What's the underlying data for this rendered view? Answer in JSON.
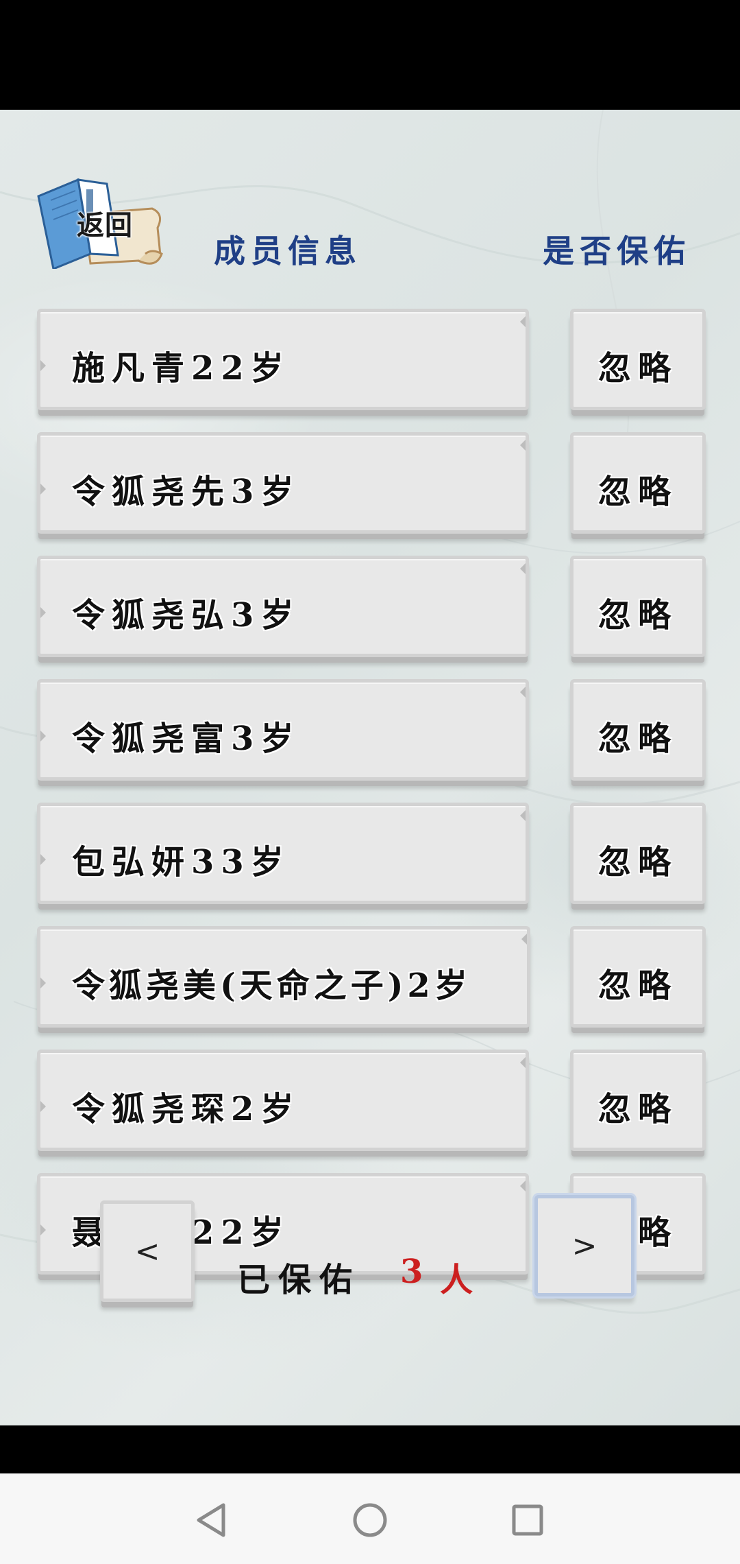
{
  "header": {
    "back_label": "返回",
    "member_info_title": "成员信息",
    "protect_title": "是否保佑"
  },
  "members": [
    {
      "name": "施凡青22岁",
      "action": "忽略"
    },
    {
      "name": "令狐尧先3岁",
      "action": "忽略"
    },
    {
      "name": "令狐尧弘3岁",
      "action": "忽略"
    },
    {
      "name": "令狐尧富3岁",
      "action": "忽略"
    },
    {
      "name": "包弘妍33岁",
      "action": "忽略"
    },
    {
      "name": "令狐尧美(天命之子)2岁",
      "action": "忽略"
    },
    {
      "name": "令狐尧琛2岁",
      "action": "忽略"
    },
    {
      "name": "聂国雅22岁",
      "action": "忽略"
    }
  ],
  "footer": {
    "prev_label": "<",
    "next_label": ">",
    "protected_label": "已保佑",
    "protected_count": "3",
    "protected_unit": "人"
  },
  "colors": {
    "header_blue": "#1f3f86",
    "count_red": "#cc1f1f",
    "button_face": "#e8e8e8"
  },
  "system_nav": {
    "icons": [
      "back-triangle-icon",
      "home-circle-icon",
      "recent-square-icon"
    ]
  }
}
